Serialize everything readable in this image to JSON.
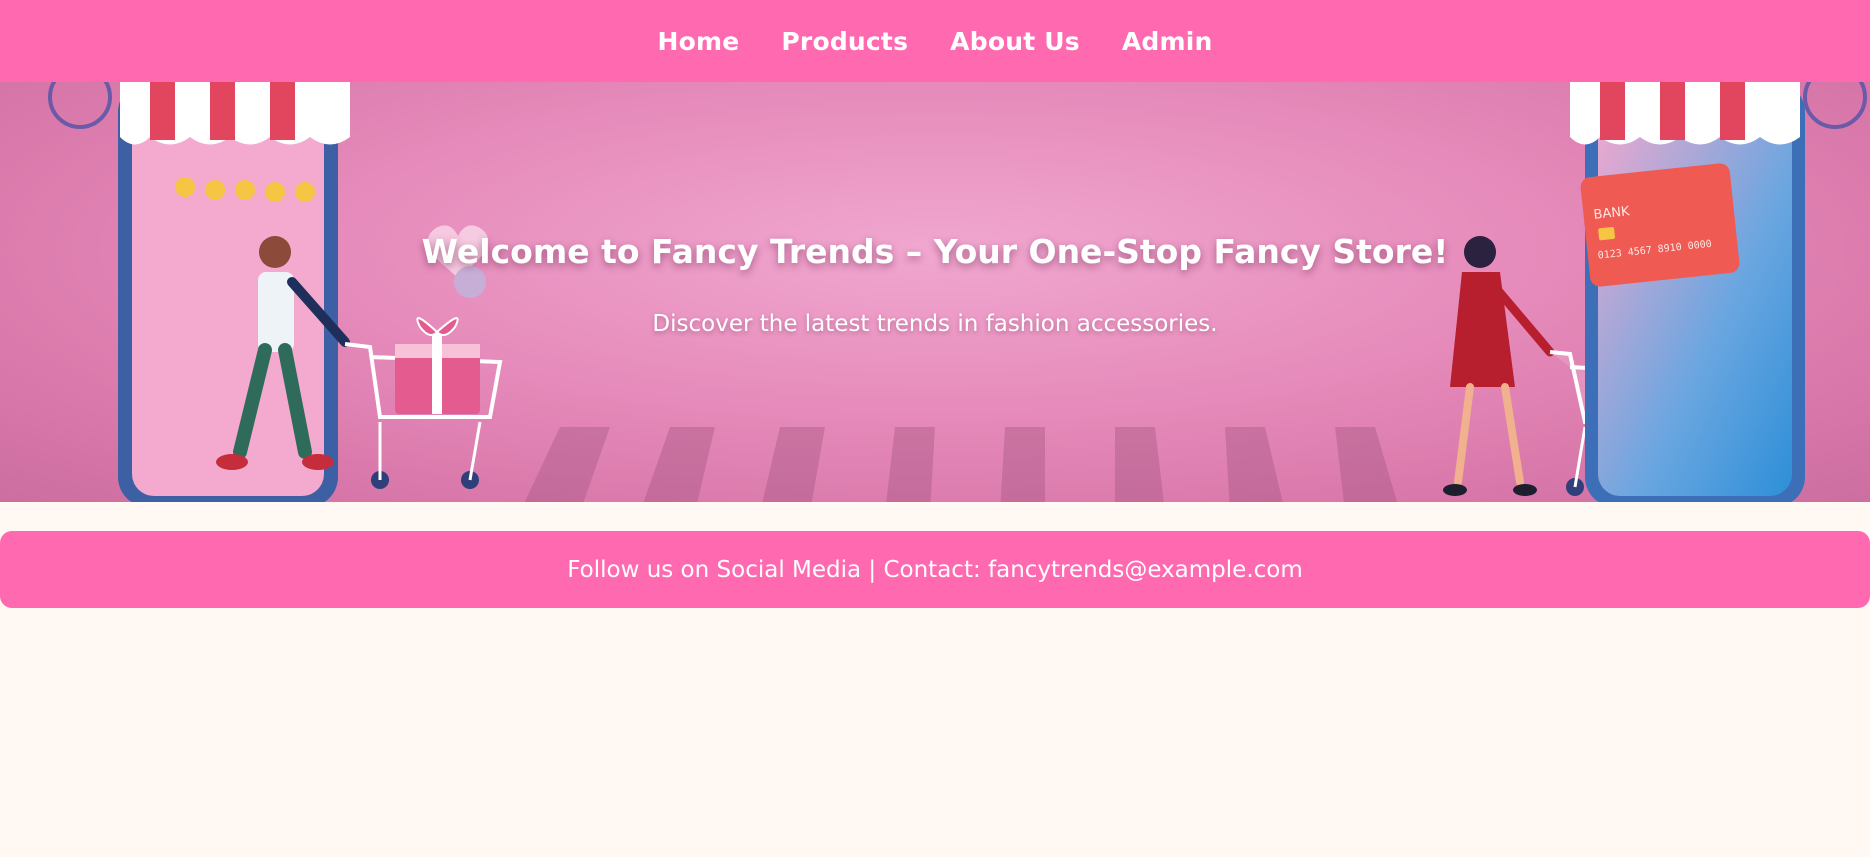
{
  "nav": {
    "items": [
      {
        "label": "Home"
      },
      {
        "label": "Products"
      },
      {
        "label": "About Us"
      },
      {
        "label": "Admin"
      }
    ]
  },
  "hero": {
    "title": "Welcome to Fancy Trends – Your One-Stop Fancy Store!",
    "subtitle": "Discover the latest trends in fashion accessories.",
    "card_text": "BANK",
    "card_number": "0123 4567 8910 0000"
  },
  "footer": {
    "text": "Follow us on Social Media | Contact: fancytrends@example.com"
  },
  "colors": {
    "brand_pink": "#ff69b0",
    "page_background": "#fff8f3"
  }
}
